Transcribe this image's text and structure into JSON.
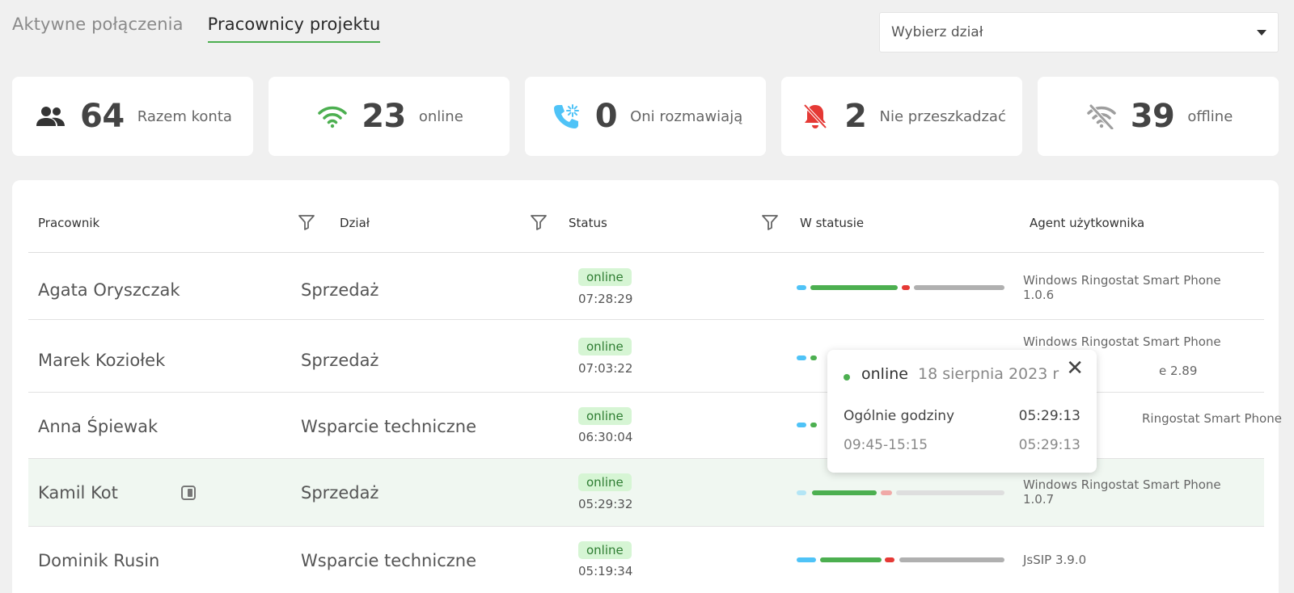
{
  "tabs": [
    {
      "label": "Aktywne połączenia",
      "active": false
    },
    {
      "label": "Pracownicy projektu",
      "active": true
    }
  ],
  "department_select": {
    "placeholder": "Wybierz dział"
  },
  "stats": [
    {
      "icon": "people-icon",
      "value": "64",
      "label": "Razem konta",
      "color": "#333333"
    },
    {
      "icon": "wifi-icon",
      "value": "23",
      "label": "online",
      "color": "#4caf50"
    },
    {
      "icon": "phone-call-icon",
      "value": "0",
      "label": "Oni rozmawiają",
      "color": "#4fc3f7"
    },
    {
      "icon": "bell-off-icon",
      "value": "2",
      "label": "Nie przeszkadzać",
      "color": "#e53935"
    },
    {
      "icon": "wifi-off-icon",
      "value": "39",
      "label": "offline",
      "color": "#9e9e9e"
    }
  ],
  "table": {
    "headers": {
      "employee": "Pracownik",
      "department": "Dział",
      "status": "Status",
      "in_status": "W statusie",
      "user_agent": "Agent użytkownika"
    },
    "rows": [
      {
        "name": "Agata Oryszczak",
        "department": "Sprzedaż",
        "status": "online",
        "time": "07:28:29",
        "agent": "Windows Ringostat Smart Phone 1.0.6"
      },
      {
        "name": "Marek Koziołek",
        "department": "Sprzedaż",
        "status": "online",
        "time": "07:03:22",
        "agent": "Windows Ringostat Smart Phone",
        "agent_extra": "e 2.89"
      },
      {
        "name": "Anna Śpiewak",
        "department": "Wsparcie techniczne",
        "status": "online",
        "time": "06:30:04",
        "agent": "Ringostat Smart Phone"
      },
      {
        "name": "Kamil Kot",
        "department": "Sprzedaż",
        "status": "online",
        "time": "05:29:32",
        "agent": "Windows Ringostat Smart Phone 1.0.7"
      },
      {
        "name": "Dominik Rusin",
        "department": "Wsparcie techniczne",
        "status": "online",
        "time": "05:19:34",
        "agent": "JsSIP 3.9.0"
      }
    ]
  },
  "tooltip": {
    "status": "online",
    "date": "18 sierpnia 2023 r",
    "total_label": "Ogólnie godziny",
    "total_value": "05:29:13",
    "range_label": "09:45-15:15",
    "range_value": "05:29:13"
  },
  "colors": {
    "accent_green": "#4caf50",
    "bar_blue": "#4fc3f7",
    "bar_red": "#e53935",
    "bar_gray": "#b0b0b0",
    "highlight_row": "#f0f7f1"
  }
}
